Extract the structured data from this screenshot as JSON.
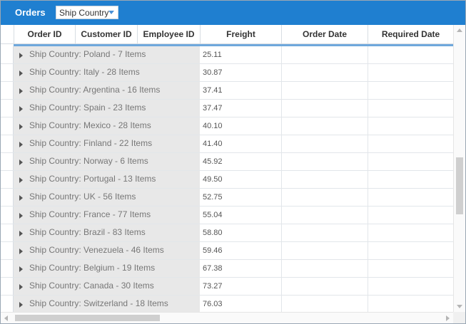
{
  "toolbar": {
    "title": "Orders",
    "group_by_value": "Ship Country"
  },
  "columns": [
    "Order ID",
    "Customer ID",
    "Employee ID",
    "Freight",
    "Order Date",
    "Required Date"
  ],
  "rows": [
    {
      "group": "Ship Country: Poland - 7 Items",
      "freight": "25.11"
    },
    {
      "group": "Ship Country: Italy - 28 Items",
      "freight": "30.87"
    },
    {
      "group": "Ship Country: Argentina - 16 Items",
      "freight": "37.41"
    },
    {
      "group": "Ship Country: Spain - 23 Items",
      "freight": "37.47"
    },
    {
      "group": "Ship Country: Mexico - 28 Items",
      "freight": "40.10"
    },
    {
      "group": "Ship Country: Finland - 22 Items",
      "freight": "41.40"
    },
    {
      "group": "Ship Country: Norway - 6 Items",
      "freight": "45.92"
    },
    {
      "group": "Ship Country: Portugal - 13 Items",
      "freight": "49.50"
    },
    {
      "group": "Ship Country: UK - 56 Items",
      "freight": "52.75"
    },
    {
      "group": "Ship Country: France - 77 Items",
      "freight": "55.04"
    },
    {
      "group": "Ship Country: Brazil - 83 Items",
      "freight": "58.80"
    },
    {
      "group": "Ship Country: Venezuela - 46 Items",
      "freight": "59.46"
    },
    {
      "group": "Ship Country: Belgium - 19 Items",
      "freight": "67.38"
    },
    {
      "group": "Ship Country: Canada - 30 Items",
      "freight": "73.27"
    },
    {
      "group": "Ship Country: Switzerland - 18 Items",
      "freight": "76.03"
    }
  ],
  "colors": {
    "toolbar_bg": "#1f7fd0",
    "header_accent": "#6fa8dc",
    "group_bg": "#e8e8e8"
  },
  "icons": {
    "combo_arrow": "chevron-down-icon",
    "expand": "caret-right-icon"
  }
}
